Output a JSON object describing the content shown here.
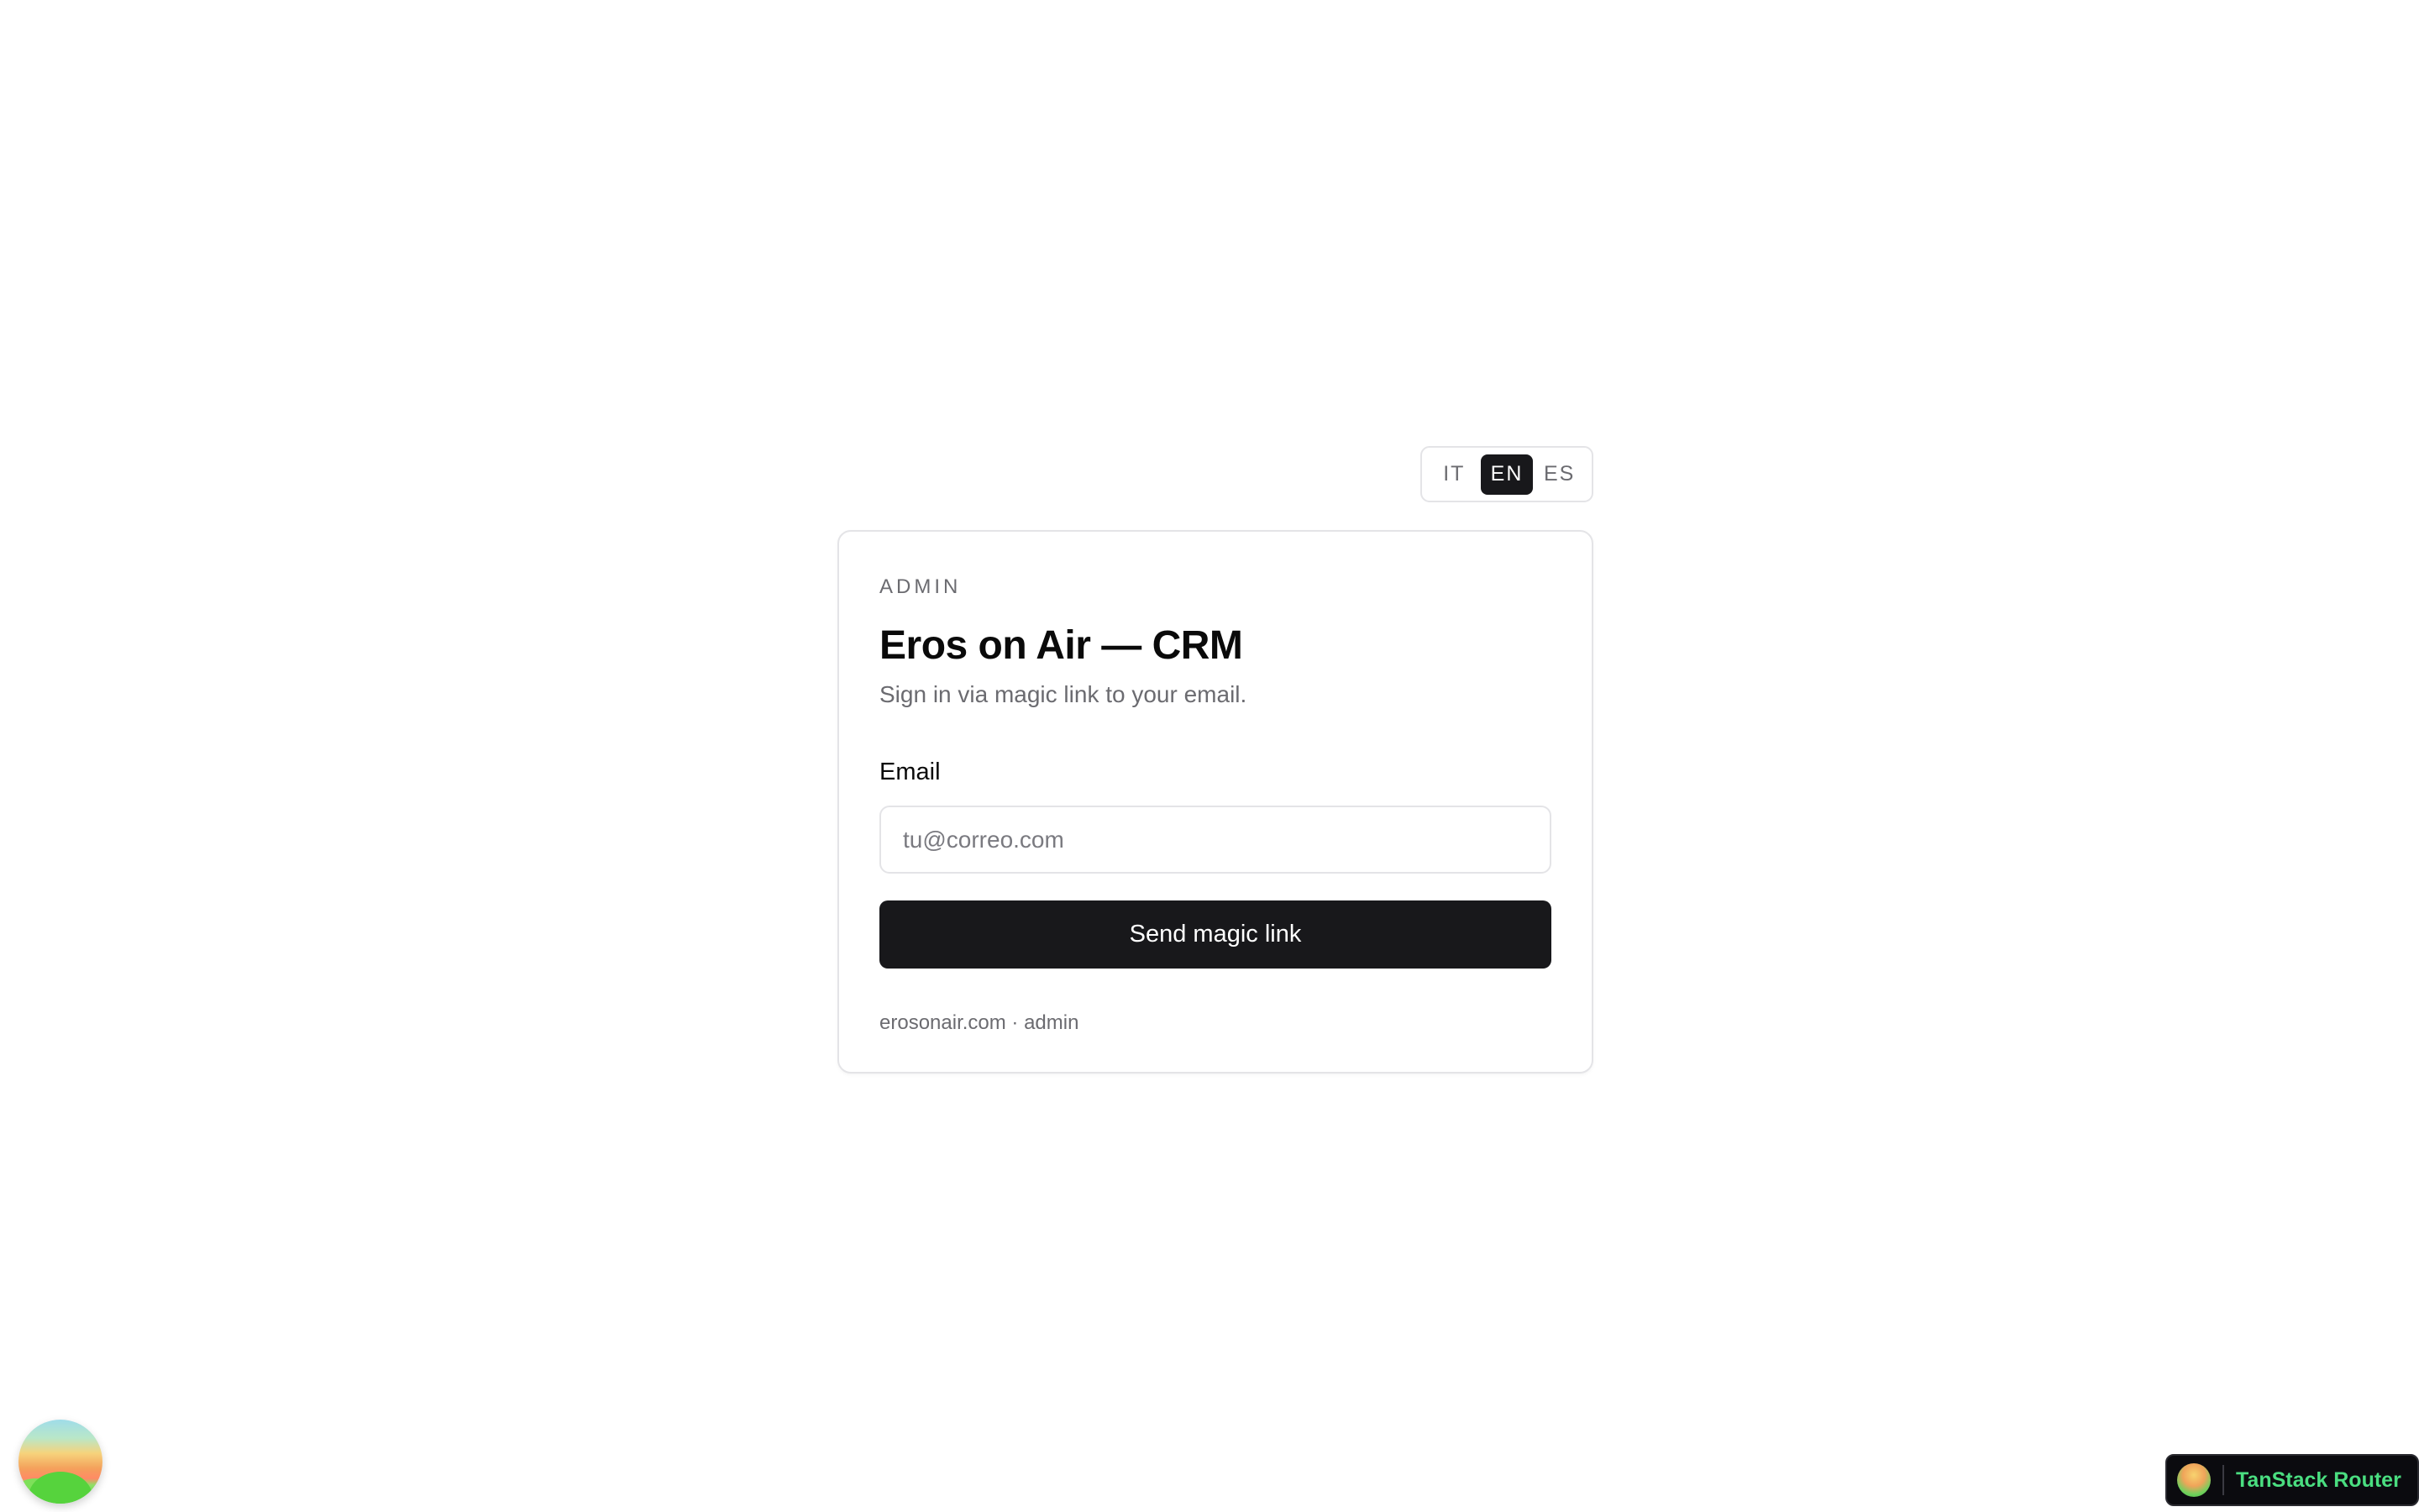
{
  "language_switcher": {
    "options": [
      {
        "code": "IT",
        "active": false
      },
      {
        "code": "EN",
        "active": true
      },
      {
        "code": "ES",
        "active": false
      }
    ]
  },
  "login_card": {
    "eyebrow": "ADMIN",
    "title": "Eros on Air — CRM",
    "subtitle": "Sign in via magic link to your email.",
    "email_label": "Email",
    "email_value": "",
    "email_placeholder": "tu@correo.com",
    "submit_label": "Send magic link",
    "footer": "erosonair.com · admin"
  },
  "devtools": {
    "orb_icon": "tanstack-devtools-icon",
    "router_badge_label": "TanStack Router",
    "router_badge_icon": "tanstack-logo-icon"
  },
  "colors": {
    "primary": "#18181b",
    "muted_text": "#6b6b70",
    "border": "#e4e4e7",
    "badge_text": "#4ade80"
  }
}
